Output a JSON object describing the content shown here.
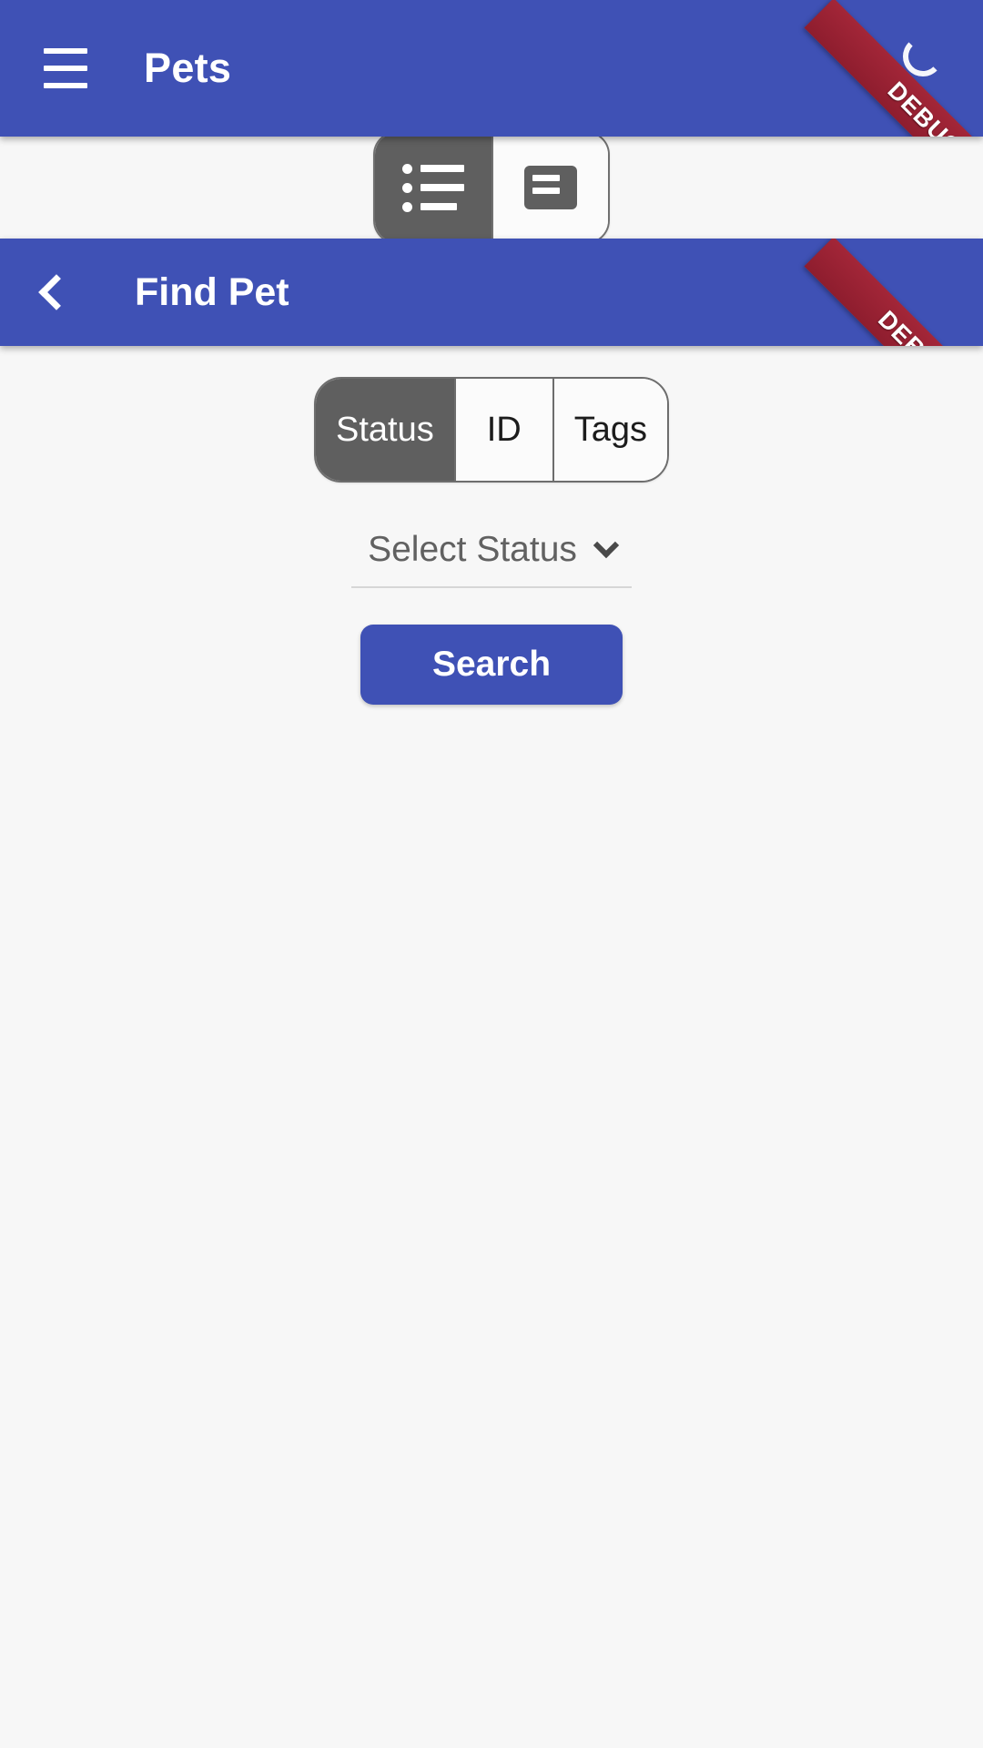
{
  "app": {
    "background_color": "#f7f7f7",
    "primary_color": "#3f51b5",
    "selected_segment_color": "#5f5f5f",
    "debug_ribbon_color": "#a32638"
  },
  "appbar": {
    "title": "Pets",
    "menu_icon": "hamburger-menu-icon",
    "debug_banner": "DEBUG",
    "spinner_icon": "loading-spinner-icon"
  },
  "view_toggle": {
    "options": [
      {
        "icon": "list-view-icon",
        "label": "List view",
        "selected": true
      },
      {
        "icon": "card-view-icon",
        "label": "Card view",
        "selected": false
      }
    ]
  },
  "subbar": {
    "title": "Find Pet",
    "back_icon": "chevron-left-icon",
    "debug_banner": "DEBUG"
  },
  "search_form": {
    "mode_toggle": {
      "options": [
        {
          "label": "Status",
          "selected": true
        },
        {
          "label": "ID",
          "selected": false
        },
        {
          "label": "Tags",
          "selected": false
        }
      ]
    },
    "status_dropdown": {
      "value": "Select Status",
      "placeholder": "Select Status",
      "chevron_icon": "chevron-down-icon"
    },
    "submit_label": "Search"
  }
}
